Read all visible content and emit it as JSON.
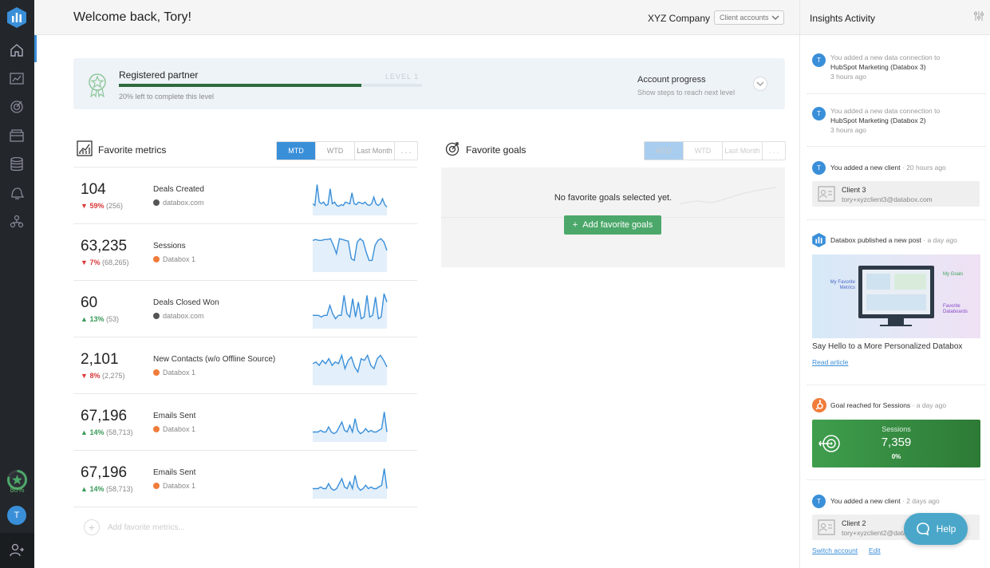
{
  "header": {
    "welcome": "Welcome back, Tory!",
    "company": "XYZ Company",
    "client_accounts": "Client accounts"
  },
  "sidebar": {
    "items": [
      "home-icon",
      "dashboard-icon",
      "goals-icon",
      "databoards-icon",
      "data-icon",
      "alerts-icon",
      "team-icon"
    ],
    "progress_pct": "80%",
    "progress_value": 0.8,
    "avatar_initial": "T"
  },
  "partner": {
    "title": "Registered partner",
    "level": "LEVEL 1",
    "sub": "20% left to complete this level",
    "progress": 0.8,
    "account_progress": "Account progress",
    "account_progress_sub": "Show steps to reach next level"
  },
  "metrics": {
    "title": "Favorite metrics",
    "tabs": [
      "MTD",
      "WTD",
      "Last Month",
      ". . ."
    ],
    "rows": [
      {
        "value": "104",
        "arrow": "▼",
        "dir": "down",
        "pct": "59%",
        "prev": "(256)",
        "name": "Deals Created",
        "source": "databox.com",
        "src": "dbx",
        "spark": [
          12,
          10,
          35,
          14,
          12,
          14,
          10,
          11,
          30,
          12,
          14,
          10,
          9,
          11,
          10,
          14,
          13,
          12,
          25,
          12,
          11,
          14,
          13,
          12,
          14,
          11,
          10,
          12,
          20,
          12,
          10,
          12,
          18,
          11,
          8
        ]
      },
      {
        "value": "63,235",
        "arrow": "▼",
        "dir": "down",
        "pct": "7%",
        "prev": "(68,265)",
        "name": "Sessions",
        "source": "Databox 1",
        "src": "hs",
        "spark": [
          36,
          37,
          36,
          36,
          37,
          37,
          38,
          30,
          20,
          38,
          37,
          36,
          35,
          14,
          12,
          34,
          38,
          35,
          22,
          12,
          12,
          30,
          36,
          38,
          34,
          24
        ]
      },
      {
        "value": "60",
        "arrow": "▲",
        "dir": "up",
        "pct": "13%",
        "prev": "(53)",
        "name": "Deals Closed Won",
        "source": "databox.com",
        "src": "dbx",
        "spark": [
          14,
          14,
          14,
          12,
          14,
          14,
          26,
          16,
          10,
          14,
          14,
          38,
          16,
          12,
          34,
          12,
          30,
          10,
          12,
          38,
          12,
          14,
          36,
          10,
          12,
          40,
          30
        ]
      },
      {
        "value": "2,101",
        "arrow": "▼",
        "dir": "down",
        "pct": "8%",
        "prev": "(2,275)",
        "name": "New Contacts (w/o Offline Source)",
        "source": "Databox 1",
        "src": "hs",
        "spark": [
          24,
          26,
          22,
          28,
          24,
          30,
          22,
          26,
          24,
          34,
          18,
          28,
          32,
          20,
          14,
          30,
          28,
          34,
          22,
          18,
          30,
          34,
          28,
          20
        ]
      },
      {
        "value": "67,196",
        "arrow": "▲",
        "dir": "up",
        "pct": "14%",
        "prev": "(58,713)",
        "name": "Emails Sent",
        "source": "Databox 1",
        "src": "hs",
        "spark": [
          10,
          10,
          10,
          12,
          10,
          10,
          16,
          10,
          8,
          10,
          16,
          22,
          12,
          10,
          18,
          10,
          26,
          12,
          8,
          10,
          14,
          10,
          12,
          10,
          10,
          12,
          14,
          34,
          10
        ]
      },
      {
        "value": "67,196",
        "arrow": "▲",
        "dir": "up",
        "pct": "14%",
        "prev": "(58,713)",
        "name": "Emails Sent",
        "source": "Databox 1",
        "src": "hs",
        "spark": [
          10,
          10,
          10,
          12,
          10,
          10,
          16,
          10,
          8,
          10,
          16,
          22,
          12,
          10,
          18,
          10,
          26,
          12,
          8,
          10,
          14,
          10,
          12,
          10,
          10,
          12,
          14,
          34,
          10
        ]
      }
    ],
    "add_label": "Add favorite metrics..."
  },
  "goals": {
    "title": "Favorite goals",
    "tabs": [
      "MTD",
      "WTD",
      "Last Month",
      ". . ."
    ],
    "empty": "No favorite goals selected yet.",
    "add_button": "Add favorite goals"
  },
  "panel": {
    "title": "Insights Activity",
    "a1": {
      "avatar": "T",
      "pre": "You added a new data connection to",
      "target": "HubSpot Marketing (Databox 3)",
      "time": "3 hours ago"
    },
    "a2": {
      "avatar": "T",
      "pre": "You added a new data connection to",
      "target": "HubSpot Marketing (Databox 2)",
      "time": "3 hours ago"
    },
    "a3": {
      "avatar": "T",
      "text": "You added a new client",
      "time": "· 20 hours ago",
      "client_name": "Client 3",
      "client_email": "tory+xyzclient3@databox.com"
    },
    "a4": {
      "text": "Databox published a new post",
      "time": "· a day ago",
      "post_title": "Say Hello to a More Personalized Databox",
      "read_article": "Read article",
      "img_labels": {
        "metrics": "My Favorite Metrics",
        "goals": "My Goals",
        "databoards": "Favorite Databoards"
      }
    },
    "a5": {
      "text": "Goal reached for Sessions",
      "time": "· a day ago",
      "goal_name": "Sessions",
      "goal_value": "7,359",
      "goal_pct": "0%"
    },
    "a6": {
      "avatar": "T",
      "text": "You added a new client",
      "time": "· 2 days ago",
      "client_name": "Client 2",
      "client_email": "tory+xyzclient2@databox.com",
      "switch": "Switch account",
      "edit": "Edit"
    }
  },
  "help": {
    "label": "Help"
  },
  "colors": {
    "accent": "#3a8fd9",
    "green": "#4ca86a",
    "down": "#d9393b",
    "up": "#3a9a59",
    "sidebar": "#23272b"
  }
}
